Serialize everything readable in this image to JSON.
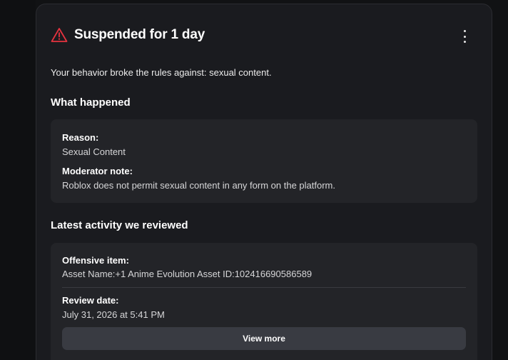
{
  "colors": {
    "background": "#111214",
    "card": "#1a1b1f",
    "inner_box": "#232428",
    "warning": "#e5333f",
    "button": "#393b42"
  },
  "header": {
    "icon": "warning-triangle-icon",
    "title": "Suspended for 1 day",
    "menu_icon": "more-vertical-icon"
  },
  "summary": "Your behavior broke the rules against: sexual content.",
  "what_happened": {
    "title": "What happened",
    "reason_label": "Reason:",
    "reason_value": "Sexual Content",
    "note_label": "Moderator note:",
    "note_value": "Roblox does not permit sexual content in any form on the platform."
  },
  "latest_activity": {
    "title": "Latest activity we reviewed",
    "item_label": "Offensive item:",
    "item_value": "Asset Name:+1 Anime Evolution Asset ID:102416690586589",
    "date_label": "Review date:",
    "date_value": "July 31, 2026 at 5:41 PM",
    "button_label": "View more"
  }
}
